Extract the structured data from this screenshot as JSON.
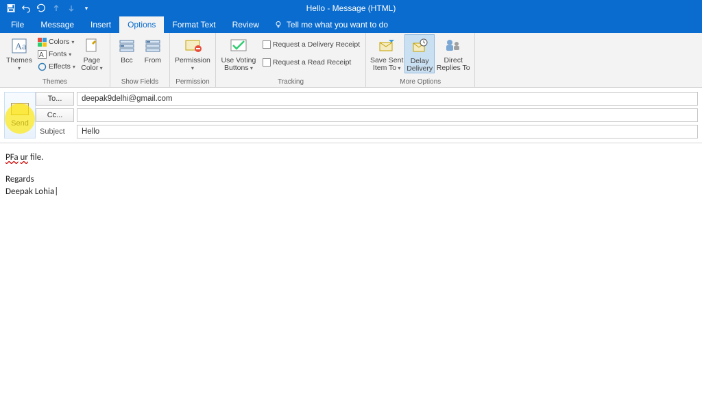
{
  "titlebar": {
    "title_left": "Hello",
    "title_sep": " - ",
    "title_right": "Message (HTML)"
  },
  "tabs": {
    "file": "File",
    "message": "Message",
    "insert": "Insert",
    "options": "Options",
    "format_text": "Format Text",
    "review": "Review",
    "tell_me": "Tell me what you want to do"
  },
  "ribbon": {
    "themes": {
      "label": "Themes",
      "themes_btn": "Themes",
      "colors": "Colors",
      "fonts": "Fonts",
      "effects": "Effects",
      "page_color": "Page\nColor"
    },
    "show_fields": {
      "label": "Show Fields",
      "bcc": "Bcc",
      "from": "From"
    },
    "permission": {
      "label": "Permission",
      "permission_btn": "Permission"
    },
    "tracking": {
      "label": "Tracking",
      "voting": "Use Voting\nButtons",
      "delivery_receipt": "Request a Delivery Receipt",
      "read_receipt": "Request a Read Receipt"
    },
    "more_options": {
      "label": "More Options",
      "save_sent": "Save Sent\nItem To",
      "delay": "Delay\nDelivery",
      "direct": "Direct\nReplies To"
    }
  },
  "compose": {
    "send": "Send",
    "to_label": "To...",
    "cc_label": "Cc...",
    "subject_label": "Subject",
    "to_value": "deepak9delhi@gmail.com",
    "cc_value": "",
    "subject_value": "Hello"
  },
  "body": {
    "line1a": "PFa",
    "line1b": "ur",
    "line1c": " file.",
    "regards": "Regards",
    "signature": "Deepak Lohia"
  }
}
